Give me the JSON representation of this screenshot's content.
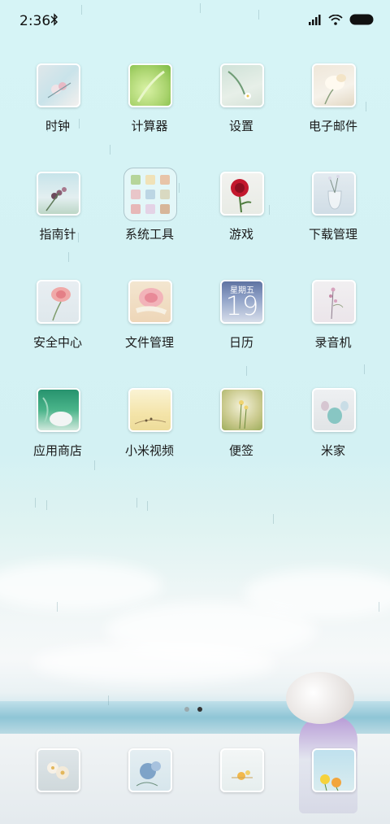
{
  "status_bar": {
    "time": "2:36",
    "icons": [
      "bluetooth-icon",
      "signal-icon",
      "wifi-icon",
      "battery-icon"
    ]
  },
  "apps": [
    {
      "label": "时钟",
      "icon": "clock-icon"
    },
    {
      "label": "计算器",
      "icon": "calculator-icon"
    },
    {
      "label": "设置",
      "icon": "settings-icon"
    },
    {
      "label": "电子邮件",
      "icon": "email-icon"
    },
    {
      "label": "指南针",
      "icon": "compass-icon"
    },
    {
      "label": "系统工具",
      "icon": "folder-icon"
    },
    {
      "label": "游戏",
      "icon": "games-icon"
    },
    {
      "label": "下载管理",
      "icon": "download-icon"
    },
    {
      "label": "安全中心",
      "icon": "security-icon"
    },
    {
      "label": "文件管理",
      "icon": "file-manager-icon"
    },
    {
      "label": "日历",
      "icon": "calendar-icon",
      "day": "星期五",
      "date": "19"
    },
    {
      "label": "录音机",
      "icon": "recorder-icon"
    },
    {
      "label": "应用商店",
      "icon": "app-store-icon"
    },
    {
      "label": "小米视频",
      "icon": "video-icon"
    },
    {
      "label": "便签",
      "icon": "notes-icon"
    },
    {
      "label": "米家",
      "icon": "mijia-icon"
    }
  ],
  "page_indicator": {
    "pages": 2,
    "current": 2
  },
  "dock": [
    {
      "icon": "phone-icon"
    },
    {
      "icon": "messages-icon"
    },
    {
      "icon": "browser-icon"
    },
    {
      "icon": "camera-icon"
    }
  ],
  "colors": {
    "sky": "#d6f4f6",
    "label_text": "#1a1a1a",
    "dot_active": "#333333",
    "dot_inactive": "#9aa9ad"
  }
}
